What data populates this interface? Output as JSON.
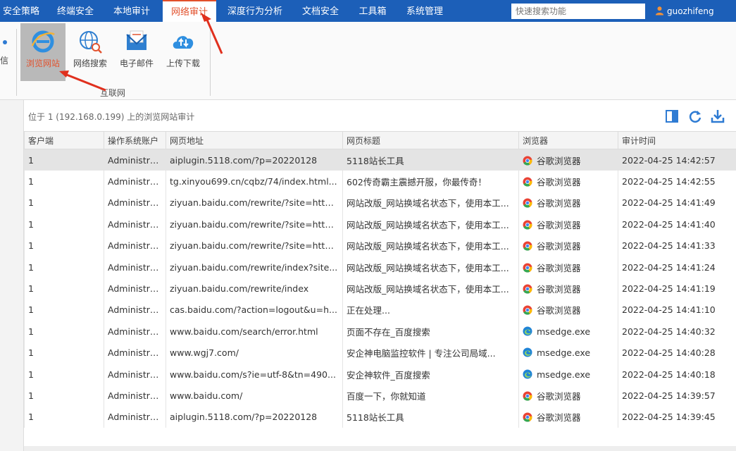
{
  "nav": {
    "tabs": [
      {
        "label": "安全策略"
      },
      {
        "label": "终端安全"
      },
      {
        "label": "本地审计"
      },
      {
        "label": "网络审计"
      },
      {
        "label": "深度行为分析"
      },
      {
        "label": "文档安全"
      },
      {
        "label": "工具箱"
      },
      {
        "label": "系统管理"
      }
    ],
    "active_tab": "网络审计",
    "search_placeholder": "快速搜索功能",
    "username": "guozhifeng"
  },
  "ribbon": {
    "prev_label": "信",
    "buttons": [
      {
        "label": "浏览网站",
        "icon": "ie-icon"
      },
      {
        "label": "网络搜索",
        "icon": "globe-search-icon"
      },
      {
        "label": "电子邮件",
        "icon": "email-icon"
      },
      {
        "label": "上传下载",
        "icon": "cloud-upload-download-icon"
      }
    ],
    "group_label": "互联网"
  },
  "content": {
    "subtitle": "位于 1 (192.168.0.199) 上的浏览网站审计",
    "columns": [
      "客户端",
      "操作系统账户",
      "网页地址",
      "网页标题",
      "浏览器",
      "审计时间"
    ],
    "rows": [
      {
        "client": "1",
        "account": "Administra...",
        "url": "aiplugin.5118.com/?p=20220128",
        "title": "5118站长工具",
        "browser": "谷歌浏览器",
        "bicon": "chrome",
        "time": "2022-04-25 14:42:57"
      },
      {
        "client": "1",
        "account": "Administra...",
        "url": "tg.xinyou699.cn/cqbz/74/index.html...",
        "title": "602传奇霸主震撼开服，你最传奇！",
        "browser": "谷歌浏览器",
        "bicon": "chrome",
        "time": "2022-04-25 14:42:55"
      },
      {
        "client": "1",
        "account": "Administra...",
        "url": "ziyuan.baidu.com/rewrite/?site=http...",
        "title": "网站改版_网站换域名状态下，使用本工...",
        "browser": "谷歌浏览器",
        "bicon": "chrome",
        "time": "2022-04-25 14:41:49"
      },
      {
        "client": "1",
        "account": "Administra...",
        "url": "ziyuan.baidu.com/rewrite/?site=http...",
        "title": "网站改版_网站换域名状态下，使用本工...",
        "browser": "谷歌浏览器",
        "bicon": "chrome",
        "time": "2022-04-25 14:41:40"
      },
      {
        "client": "1",
        "account": "Administra...",
        "url": "ziyuan.baidu.com/rewrite/?site=http...",
        "title": "网站改版_网站换域名状态下，使用本工...",
        "browser": "谷歌浏览器",
        "bicon": "chrome",
        "time": "2022-04-25 14:41:33"
      },
      {
        "client": "1",
        "account": "Administra...",
        "url": "ziyuan.baidu.com/rewrite/index?site...",
        "title": "网站改版_网站换域名状态下，使用本工...",
        "browser": "谷歌浏览器",
        "bicon": "chrome",
        "time": "2022-04-25 14:41:24"
      },
      {
        "client": "1",
        "account": "Administra...",
        "url": "ziyuan.baidu.com/rewrite/index",
        "title": "网站改版_网站换域名状态下，使用本工...",
        "browser": "谷歌浏览器",
        "bicon": "chrome",
        "time": "2022-04-25 14:41:19"
      },
      {
        "client": "1",
        "account": "Administra...",
        "url": "cas.baidu.com/?action=logout&u=h...",
        "title": "正在处理...",
        "browser": "谷歌浏览器",
        "bicon": "chrome",
        "time": "2022-04-25 14:41:10"
      },
      {
        "client": "1",
        "account": "Administra...",
        "url": "www.baidu.com/search/error.html",
        "title": "页面不存在_百度搜索",
        "browser": "msedge.exe",
        "bicon": "edge",
        "time": "2022-04-25 14:40:32"
      },
      {
        "client": "1",
        "account": "Administra...",
        "url": "www.wgj7.com/",
        "title": "安企神电脑监控软件 | 专注公司局域...",
        "browser": "msedge.exe",
        "bicon": "edge",
        "time": "2022-04-25 14:40:28"
      },
      {
        "client": "1",
        "account": "Administra...",
        "url": "www.baidu.com/s?ie=utf-8&tn=490...",
        "title": "安企神软件_百度搜索",
        "browser": "msedge.exe",
        "bicon": "edge",
        "time": "2022-04-25 14:40:18"
      },
      {
        "client": "1",
        "account": "Administra...",
        "url": "www.baidu.com/",
        "title": "百度一下，你就知道",
        "browser": "谷歌浏览器",
        "bicon": "chrome",
        "time": "2022-04-25 14:39:57"
      },
      {
        "client": "1",
        "account": "Administra...",
        "url": "aiplugin.5118.com/?p=20220128",
        "title": "5118站长工具",
        "browser": "谷歌浏览器",
        "bicon": "chrome",
        "time": "2022-04-25 14:39:45"
      }
    ],
    "selected_row": 0
  },
  "colors": {
    "nav_bg": "#1c5fb8",
    "accent_red": "#e2522e",
    "selected_button_bg": "#b9b9b9",
    "selected_row_bg": "#e4e4e4",
    "toolbar_blue": "#2e7bd3"
  }
}
